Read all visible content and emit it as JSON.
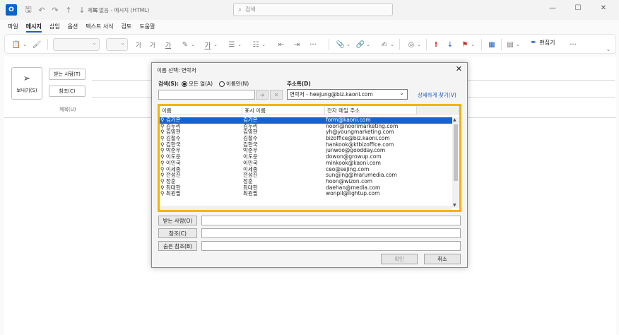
{
  "titlebar": {
    "app_logo": "O",
    "document_title": "제목 없음 - 메시지 (HTML)",
    "search_placeholder": "검색",
    "window_controls": [
      "—",
      "☐",
      "✕"
    ]
  },
  "menu": {
    "tabs": [
      "파일",
      "메시지",
      "삽입",
      "옵션",
      "텍스트 서식",
      "검토",
      "도움말"
    ],
    "active": "메시지"
  },
  "ribbon": {
    "font_size_buttons": [
      "가",
      "가",
      "가"
    ],
    "editor_label": "편집기",
    "more": "···",
    "colors": {
      "important": "#d02a2a",
      "low": "#1d5fc5",
      "accent": "#0a64c8"
    }
  },
  "compose": {
    "send_label": "보내기(S)",
    "to_label": "받는 사람(T)",
    "cc_label": "참조(C)",
    "subject_label": "제목(U)"
  },
  "dialog": {
    "title": "이름 선택: 연락처",
    "search_label": "검색(S):",
    "radio_all_columns": "모든 열(A)",
    "radio_name_only": "이름만(N)",
    "address_book_label": "주소록(D)",
    "address_book_value": "연락처 - heejung@biz.kaoni.com",
    "advanced_find": "상세하게 찾기(V)",
    "go_arrow": "➔",
    "clear_x": "✕",
    "columns": [
      "이름",
      "표시 이름",
      "전자 메일 주소"
    ],
    "contacts": [
      {
        "name": "김가온",
        "display": "김가온",
        "email": "form@kaoni.com",
        "selected": true
      },
      {
        "name": "김누리",
        "display": "김누리",
        "email": "noori@noorimarketing.com"
      },
      {
        "name": "김영현",
        "display": "김영현",
        "email": "yh@youngmarketing.com"
      },
      {
        "name": "김철수",
        "display": "김철수",
        "email": "bizoffice@biz.kaoni.com"
      },
      {
        "name": "김한국",
        "display": "김한국",
        "email": "hankook@ktbizoffice.com"
      },
      {
        "name": "박준우",
        "display": "박준우",
        "email": "junwoo@goodday.com"
      },
      {
        "name": "이도운",
        "display": "이도운",
        "email": "dowon@growup.com"
      },
      {
        "name": "이민국",
        "display": "이민국",
        "email": "minkook@kaoni.com"
      },
      {
        "name": "이세종",
        "display": "이세종",
        "email": "ceo@sejing.com"
      },
      {
        "name": "전성진",
        "display": "전성진",
        "email": "sungjing@marumedia.com"
      },
      {
        "name": "정훈",
        "display": "정훈",
        "email": "hoon@wizon.com"
      },
      {
        "name": "최대한",
        "display": "최대한",
        "email": "daehan@media.com"
      },
      {
        "name": "최원필",
        "display": "최원필",
        "email": "wonpil@lightup.com"
      }
    ],
    "to_button": "받는 사람(O)",
    "cc_button": "참조(C)",
    "bcc_button": "숨은 참조(B)",
    "ok_button": "확인",
    "cancel_button": "취소"
  }
}
